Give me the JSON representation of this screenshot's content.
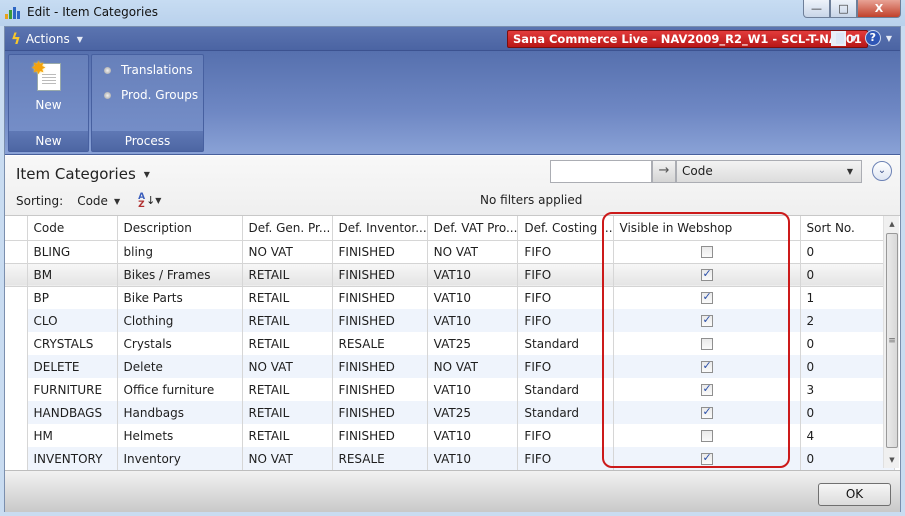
{
  "window": {
    "title": "Edit - Item Categories",
    "minimize_label": "—",
    "maximize_label": "□",
    "close_label": "X"
  },
  "command_bar": {
    "actions_label": "Actions",
    "company_label": "Sana Commerce Live - NAV2009_R2_W1 - SCL-T-NAV01",
    "help_label": "?"
  },
  "ribbon": {
    "groups": [
      {
        "label": "New",
        "items": [
          {
            "label": "New",
            "icon": "new-document-icon"
          }
        ]
      },
      {
        "label": "Process",
        "items": [
          {
            "label": "Translations",
            "icon": "bullet-icon"
          },
          {
            "label": "Prod. Groups",
            "icon": "bullet-icon"
          }
        ]
      }
    ]
  },
  "list": {
    "title": "Item Categories",
    "sorting_label": "Sorting:",
    "sorting_value": "Code",
    "filter_status": "No filters applied",
    "search_value": "",
    "search_field": "Code"
  },
  "grid": {
    "columns": [
      "Code",
      "Description",
      "Def. Gen. Pr...",
      "Def. Inventor...",
      "Def. VAT Pro...",
      "Def. Costing ...",
      "Visible in Webshop",
      "Sort No."
    ],
    "rows": [
      {
        "code": "BLING",
        "description": "bling",
        "gen": "NO VAT",
        "inv": "FINISHED",
        "vat": "NO VAT",
        "costing": "FIFO",
        "visible": false,
        "sort": "0"
      },
      {
        "code": "BM",
        "description": "Bikes / Frames",
        "gen": "RETAIL",
        "inv": "FINISHED",
        "vat": "VAT10",
        "costing": "FIFO",
        "visible": true,
        "sort": "0"
      },
      {
        "code": "BP",
        "description": "Bike Parts",
        "gen": "RETAIL",
        "inv": "FINISHED",
        "vat": "VAT10",
        "costing": "FIFO",
        "visible": true,
        "sort": "1"
      },
      {
        "code": "CLO",
        "description": "Clothing",
        "gen": "RETAIL",
        "inv": "FINISHED",
        "vat": "VAT10",
        "costing": "FIFO",
        "visible": true,
        "sort": "2"
      },
      {
        "code": "CRYSTALS",
        "description": "Crystals",
        "gen": "RETAIL",
        "inv": "RESALE",
        "vat": "VAT25",
        "costing": "Standard",
        "visible": false,
        "sort": "0"
      },
      {
        "code": "DELETE",
        "description": "Delete",
        "gen": "NO VAT",
        "inv": "FINISHED",
        "vat": "NO VAT",
        "costing": "FIFO",
        "visible": true,
        "sort": "0"
      },
      {
        "code": "FURNITURE",
        "description": "Office furniture",
        "gen": "RETAIL",
        "inv": "FINISHED",
        "vat": "VAT10",
        "costing": "Standard",
        "visible": true,
        "sort": "3"
      },
      {
        "code": "HANDBAGS",
        "description": "Handbags",
        "gen": "RETAIL",
        "inv": "FINISHED",
        "vat": "VAT25",
        "costing": "Standard",
        "visible": true,
        "sort": "0"
      },
      {
        "code": "HM",
        "description": "Helmets",
        "gen": "RETAIL",
        "inv": "FINISHED",
        "vat": "VAT10",
        "costing": "FIFO",
        "visible": false,
        "sort": "4"
      },
      {
        "code": "INVENTORY",
        "description": "Inventory",
        "gen": "NO VAT",
        "inv": "RESALE",
        "vat": "VAT10",
        "costing": "FIFO",
        "visible": true,
        "sort": "0"
      }
    ],
    "current_row": 1,
    "highlight_color": "#cc1a1a"
  },
  "footer": {
    "ok_label": "OK"
  }
}
